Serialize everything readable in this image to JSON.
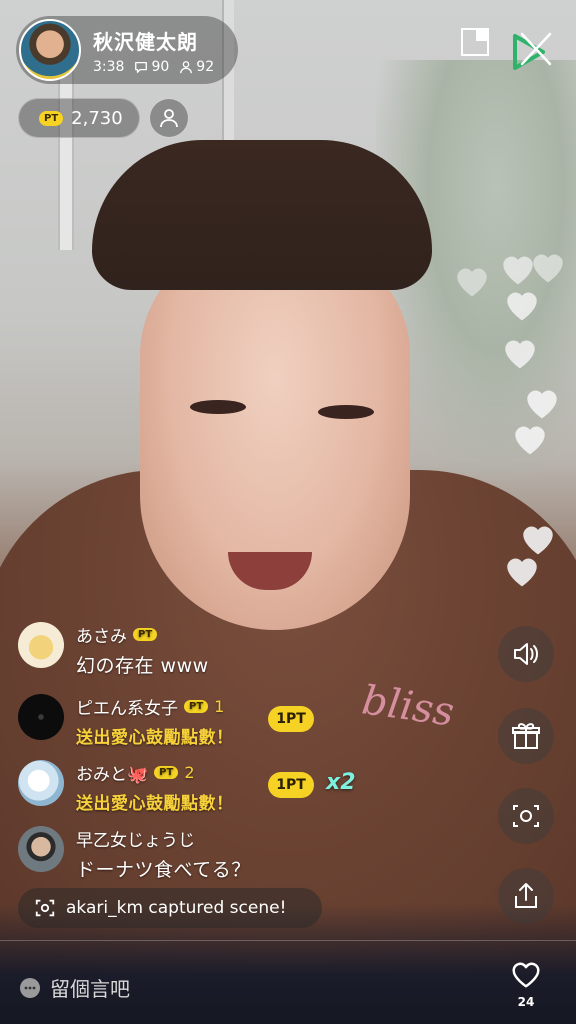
{
  "host": {
    "name": "秋沢健太朗",
    "duration": "3:38",
    "comments_count": "90",
    "viewers_count": "92"
  },
  "points": {
    "badge": "PT",
    "amount": "2,730"
  },
  "comments": [
    {
      "user": "あさみ",
      "badge": "PT",
      "text": "幻の存在 www"
    },
    {
      "user": "ピエん系女子",
      "badge": "PT",
      "pt_count": "1",
      "text": "送出愛心鼓勵點數！",
      "gift_chip": "1PT"
    },
    {
      "user": "おみと🐙",
      "badge": "PT",
      "pt_count": "2",
      "text": "送出愛心鼓勵點數！",
      "gift_chip": "1PT",
      "multiplier": "x2"
    },
    {
      "user": "早乙女じょうじ",
      "text": "ドーナツ食べてる？"
    }
  ],
  "capture_notice": "akari_km captured scene!",
  "composer": {
    "placeholder": "留個言吧",
    "like_count": "24"
  },
  "video_overlay": {
    "shirt_print": "bliss"
  },
  "icons": {
    "pip": "picture-in-picture-icon",
    "close": "close-icon",
    "logo": "play-logo-icon",
    "volume": "volume-icon",
    "gift": "gift-icon",
    "capture": "camera-capture-icon",
    "share": "share-icon",
    "like": "heart-icon"
  },
  "colors": {
    "accent_yellow": "#f5d223",
    "gift_text": "#f7d13a",
    "multiplier": "#7ef0e0"
  }
}
